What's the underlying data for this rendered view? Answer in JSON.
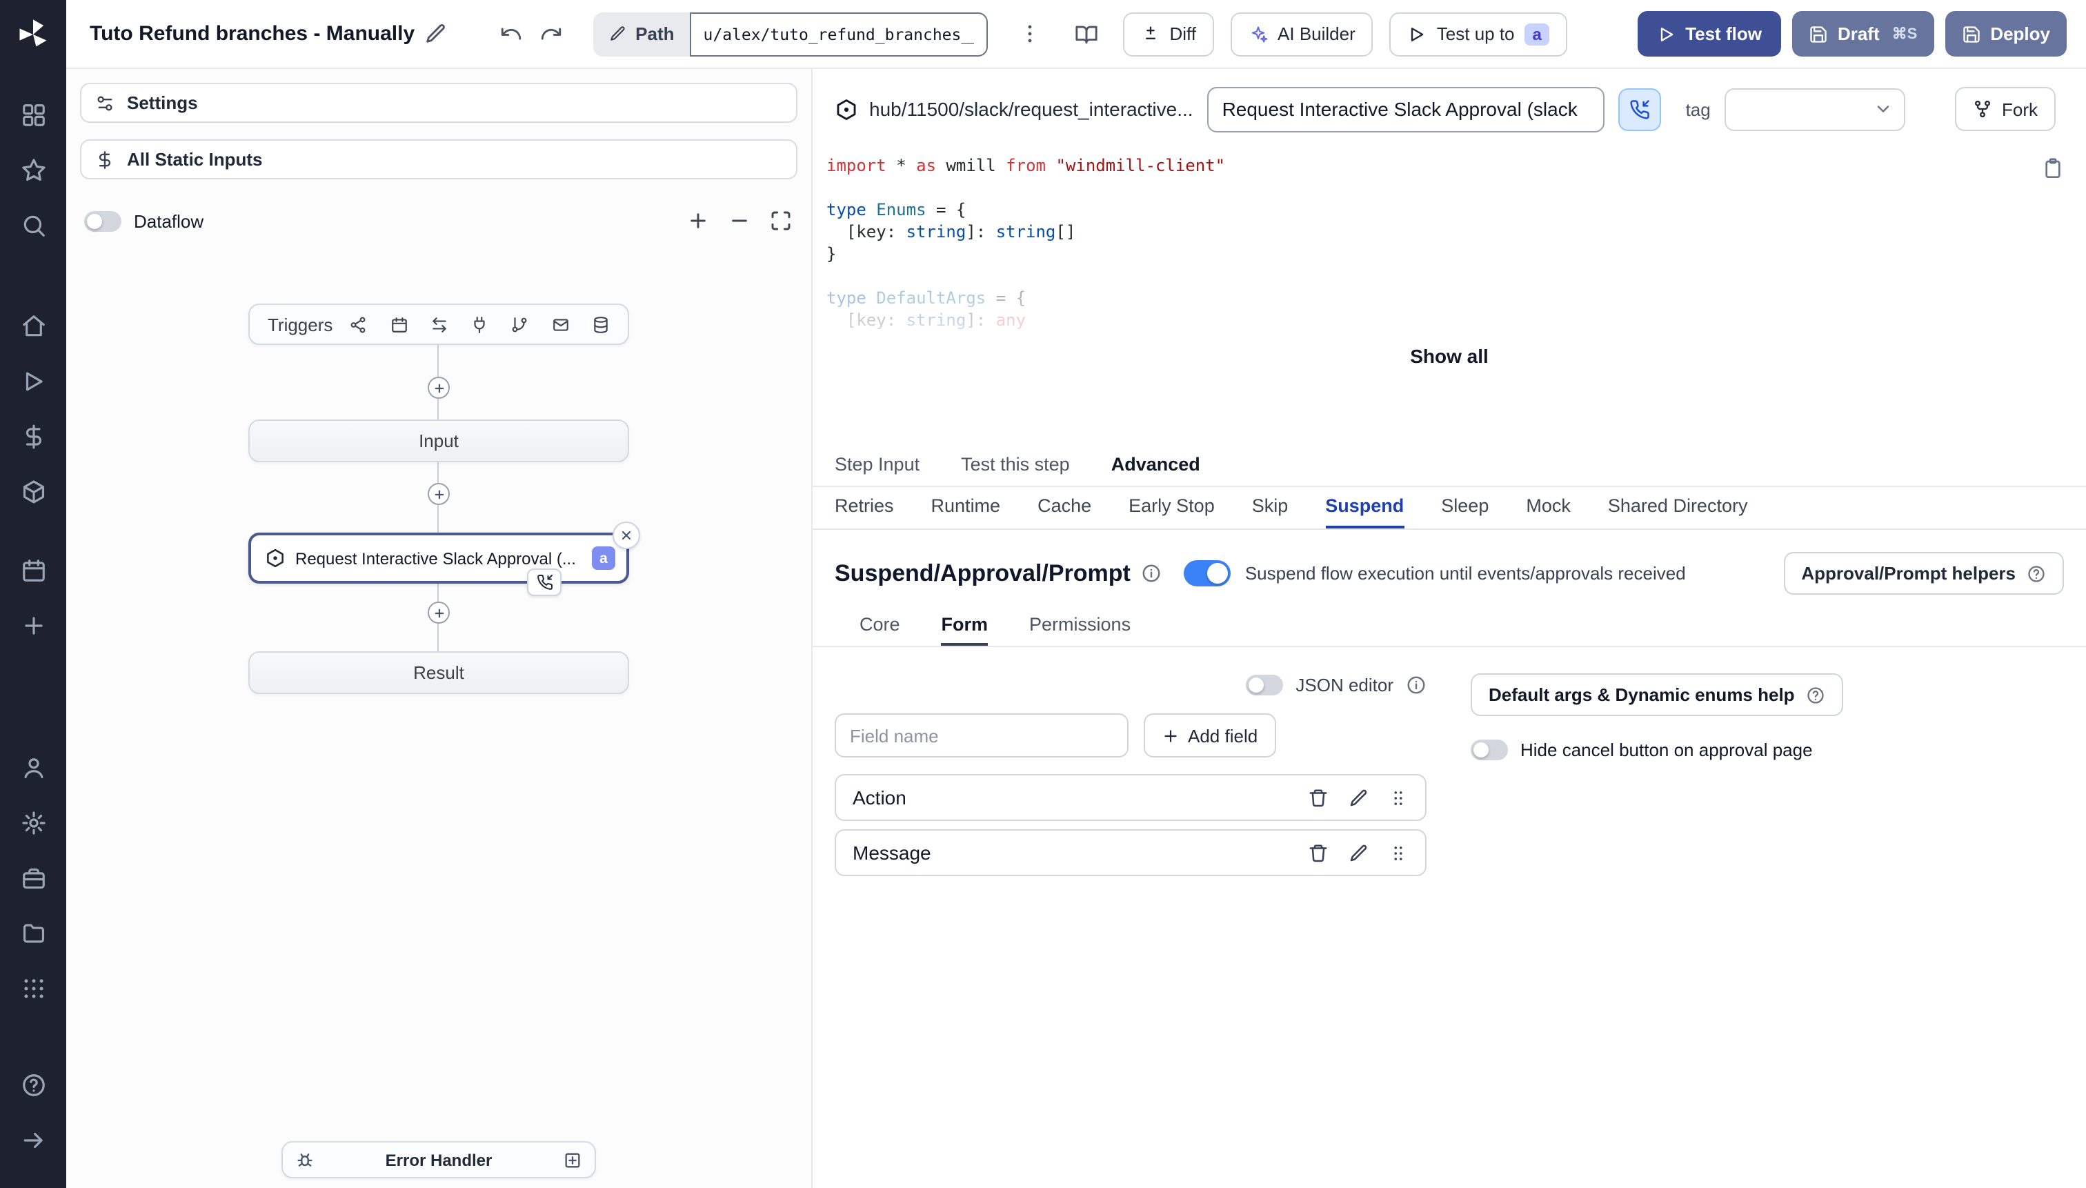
{
  "colors": {
    "sidebar": "#1d222e",
    "accent": "#3b82f6",
    "primary-btn": "#3f4f95",
    "slate-btn": "#67749e",
    "badge": "#7d8df0"
  },
  "header": {
    "title": "Tuto Refund branches - Manually",
    "path_label": "Path",
    "path_value": "u/alex/tuto_refund_branches__",
    "diff": "Diff",
    "ai_builder": "AI Builder",
    "test_up_to": "Test up to",
    "test_up_to_badge": "a",
    "test_flow": "Test flow",
    "draft": "Draft",
    "draft_shortcut": "⌘S",
    "deploy": "Deploy"
  },
  "flow_panel": {
    "settings": "Settings",
    "static_inputs": "All Static Inputs",
    "dataflow": "Dataflow",
    "nodes": {
      "triggers": "Triggers",
      "input": "Input",
      "step": "Request Interactive Slack Approval (...",
      "step_badge": "a",
      "result": "Result",
      "error_handler": "Error Handler"
    }
  },
  "step_panel": {
    "hub_path": "hub/11500/slack/request_interactive...",
    "summary": "Request Interactive Slack Approval (slack",
    "tag_label": "tag",
    "fork": "Fork",
    "show_all": "Show all",
    "tabs": [
      "Step Input",
      "Test this step",
      "Advanced"
    ],
    "advanced_tabs": [
      "Retries",
      "Runtime",
      "Cache",
      "Early Stop",
      "Skip",
      "Suspend",
      "Sleep",
      "Mock",
      "Shared Directory"
    ],
    "suspend": {
      "title": "Suspend/Approval/Prompt",
      "description": "Suspend flow execution until events/approvals received",
      "helpers": "Approval/Prompt helpers",
      "tabs": [
        "Core",
        "Form",
        "Permissions"
      ],
      "json_editor": "JSON editor",
      "field_name_placeholder": "Field name",
      "add_field": "Add field",
      "default_args_help": "Default args & Dynamic enums help",
      "hide_cancel": "Hide cancel button on approval page",
      "fields": [
        "Action",
        "Message"
      ]
    },
    "code": [
      {
        "tokens": [
          [
            "import",
            "kw"
          ],
          [
            " ",
            "pl"
          ],
          [
            "*",
            "pl"
          ],
          [
            " ",
            "pl"
          ],
          [
            "as",
            "kw"
          ],
          [
            " wmill ",
            "pl"
          ],
          [
            "from",
            "kw"
          ],
          [
            " ",
            "pl"
          ],
          [
            "\"windmill-client\"",
            "str"
          ]
        ]
      },
      {
        "tokens": []
      },
      {
        "tokens": [
          [
            "type",
            "kw2"
          ],
          [
            " ",
            "pl"
          ],
          [
            "Enums",
            "ty"
          ],
          [
            " = {",
            "pl"
          ]
        ]
      },
      {
        "tokens": [
          [
            "  [key: ",
            "pl"
          ],
          [
            "string",
            "kw2"
          ],
          [
            "]: ",
            "pl"
          ],
          [
            "string",
            "kw2"
          ],
          [
            "[]",
            "pl"
          ]
        ]
      },
      {
        "tokens": [
          [
            "}",
            "pl"
          ]
        ]
      },
      {
        "tokens": []
      },
      {
        "tokens": [
          [
            "type",
            "kw2"
          ],
          [
            " ",
            "pl"
          ],
          [
            "DefaultArgs",
            "ty"
          ],
          [
            " = {",
            "pl"
          ]
        ],
        "faded": true
      },
      {
        "tokens": [
          [
            "  [key: ",
            "pl"
          ],
          [
            "string",
            "kw2"
          ],
          [
            "]: ",
            "pl"
          ],
          [
            "any",
            "kw"
          ]
        ],
        "faded": true
      }
    ]
  }
}
